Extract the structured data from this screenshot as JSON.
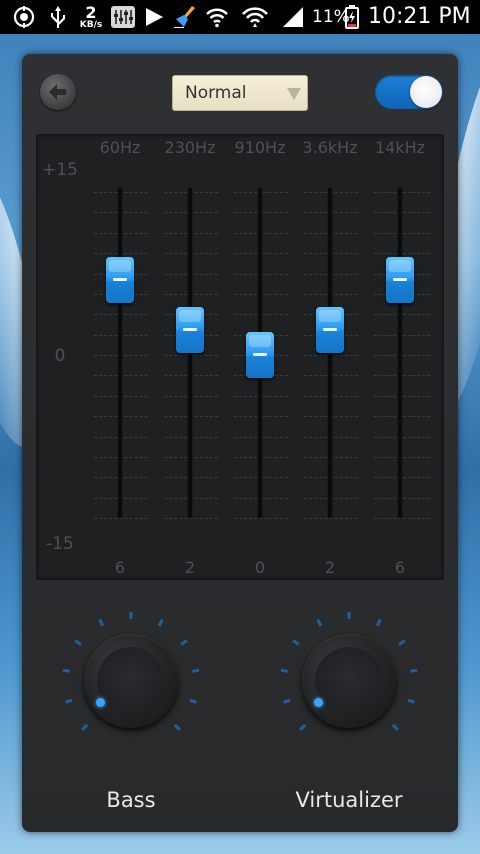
{
  "statusbar": {
    "data_speed_value": "2",
    "data_speed_unit": "KB/s",
    "battery_percent": "11%",
    "time": "10:21 PM",
    "icons": [
      "target-icon",
      "usb-icon",
      "data-speed-indicator",
      "equalizer-app-icon",
      "play-icon",
      "broom-icon",
      "wifi-icon",
      "wifi-hotspot-icon",
      "signal-icon",
      "battery-icon"
    ]
  },
  "toolbar": {
    "back_icon": "back-arrow-icon",
    "preset": "Normal",
    "toggle_on": true
  },
  "equalizer": {
    "scale_top": "+15",
    "scale_mid": "0",
    "scale_bottom": "-15",
    "bands": [
      {
        "freq": "60Hz",
        "gain_label": "6",
        "gain": 6
      },
      {
        "freq": "230Hz",
        "gain_label": "2",
        "gain": 2
      },
      {
        "freq": "910Hz",
        "gain_label": "0",
        "gain": 0
      },
      {
        "freq": "3.6kHz",
        "gain_label": "2",
        "gain": 2
      },
      {
        "freq": "14kHz",
        "gain_label": "6",
        "gain": 6
      }
    ]
  },
  "knobs": {
    "bass_label": "Bass",
    "virtualizer_label": "Virtualizer"
  },
  "colors": {
    "accent": "#1e8ef0",
    "panel": "#2c2d30",
    "eq_bg": "#1f2022"
  }
}
